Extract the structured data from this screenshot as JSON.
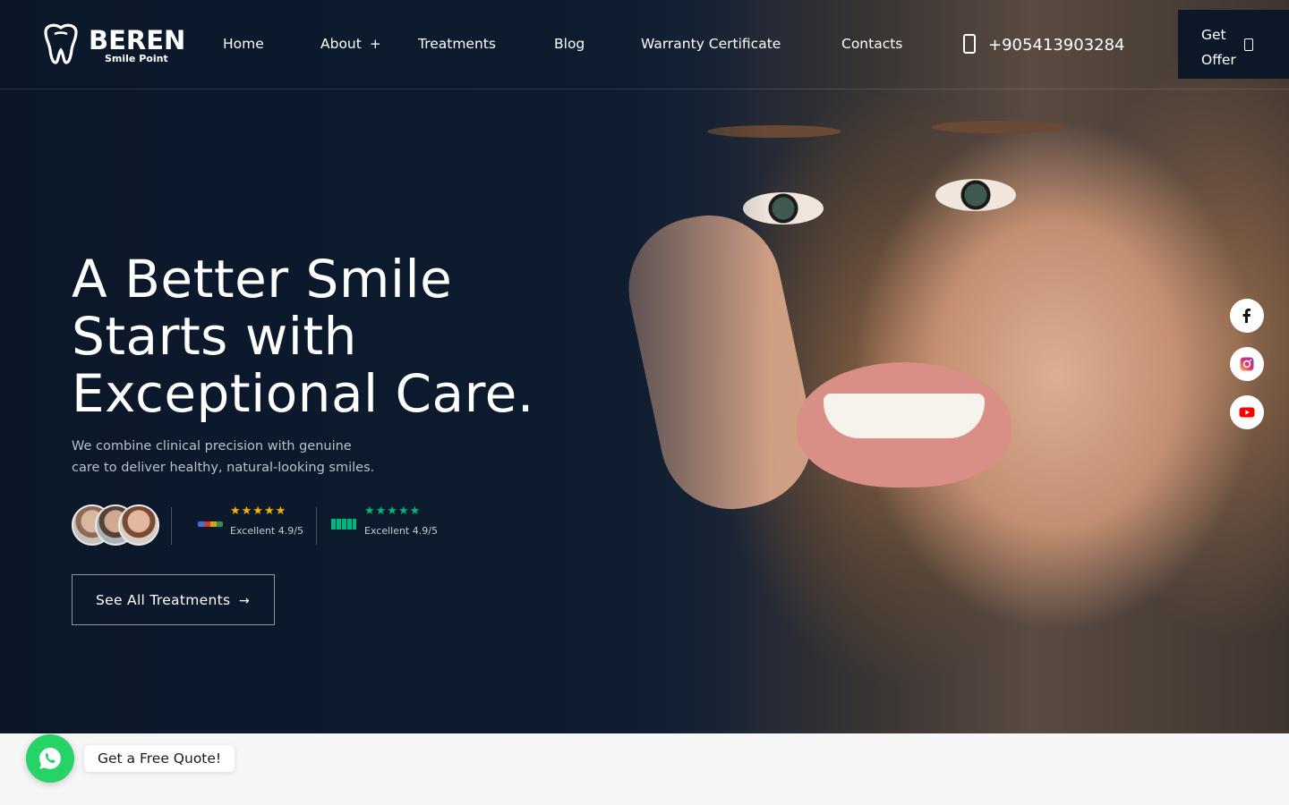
{
  "brand": {
    "name": "BEREN",
    "tagline": "Smile Point"
  },
  "nav": {
    "items": [
      {
        "label": "Home"
      },
      {
        "label": "About",
        "expand": "+"
      },
      {
        "label": "Treatments"
      },
      {
        "label": "Blog"
      },
      {
        "label": "Warranty Certificate"
      },
      {
        "label": "Contacts"
      }
    ]
  },
  "header": {
    "phone": "+905413903284",
    "cta_label": "Get Offer"
  },
  "hero": {
    "headline_line1": "A Better Smile",
    "headline_line2": "Starts with",
    "headline_line3": "Exceptional Care.",
    "subtext_line1": "We combine clinical precision with genuine",
    "subtext_line2": "care to deliver healthy, natural-looking smiles.",
    "google": {
      "stars": "★★★★★",
      "rating": "Excellent 4.9/5",
      "stars_color": "#f5b300"
    },
    "trustpilot": {
      "stars": "★★★★★",
      "rating": "Excellent 4.9/5",
      "stars_color": "#00b67a"
    },
    "cta_label": "See All Treatments",
    "cta_arrow": "→"
  },
  "social": [
    {
      "icon": "facebook-icon"
    },
    {
      "icon": "instagram-icon"
    },
    {
      "icon": "youtube-icon"
    }
  ],
  "chat": {
    "label": "Get a Free Quote!",
    "icon": "whatsapp-icon",
    "color": "#25d366"
  },
  "colors": {
    "hero_bg": "#0d1b2f",
    "accent_green": "#25d366"
  }
}
